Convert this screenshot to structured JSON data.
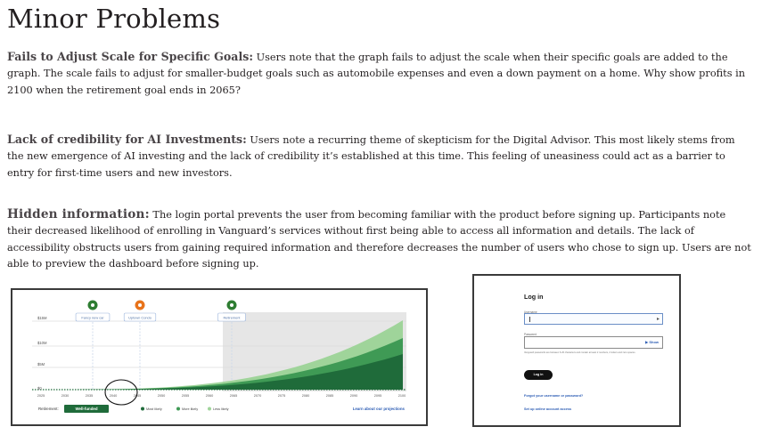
{
  "page": {
    "heading": "Minor Problems",
    "sections": [
      {
        "lead": "Fails to Adjust Scale for Specific Goals:",
        "body": " Users note that the graph fails to adjust the scale when their specific goals are added to the graph. The scale fails to adjust for smaller-budget goals such as automobile expenses and even a down payment on a home. Why show profits in 2100 when the retirement goal ends in 2065?"
      },
      {
        "lead": "Lack of credibility for AI Investments:",
        "body": "  Users note a recurring theme of skepticism for the Digital Advisor. This most likely stems from the new emergence of AI investing and the lack of credibility it’s established at this time. This feeling of uneasiness could act as a barrier to entry for first-time users and new investors."
      },
      {
        "lead": "Hidden information:",
        "body": " The login portal prevents the user from becoming familiar with the product before signing up. Participants note their decreased likelihood of enrolling in Vanguard’s services without first being able to access all information and details. The lack of accessibility obstructs users from gaining required information and therefore decreases the number of users who chose to sign up. Users are not able to preview the dashboard before signing up."
      }
    ]
  },
  "chart_screenshot": {
    "goals": [
      {
        "label": "Fancy new car",
        "icon": "car-icon",
        "color": "#2e7d32"
      },
      {
        "label": "Uptown Condo",
        "icon": "home-icon",
        "color": "#e8731a"
      },
      {
        "label": "Retirement",
        "icon": "retirement-icon",
        "color": "#2e7d32"
      }
    ],
    "y_ticks": [
      "$15M",
      "$10M",
      "$5M",
      "$0"
    ],
    "x_ticks": [
      "2025",
      "2030",
      "2035",
      "2040",
      "2045",
      "2050",
      "2055",
      "2060",
      "2065",
      "2070",
      "2075",
      "2080",
      "2085",
      "2090",
      "2095",
      "2100"
    ],
    "footer": {
      "retirement_label": "Retirement:",
      "status_badge": "Well-funded",
      "legend": [
        "Most likely",
        "More likely",
        "Less likely"
      ],
      "link": "Learn about our projections"
    },
    "colors": {
      "most_likely": "#1f6b3a",
      "more_likely": "#3f9a55",
      "less_likely": "#9fd49a",
      "retirement_shade": "#e6e6e6",
      "highlight_circle": "#111111"
    }
  },
  "login_screenshot": {
    "title": "Log in",
    "username_label": "Username",
    "password_label": "Password",
    "show_label": "Show",
    "password_hint": "Vanguard passwords are between 6-20 characters and contain at least 2 numbers, 2 letters and zero spaces.",
    "login_button": "Log in",
    "forgot_link": "Forgot your username or password?",
    "setup_link": "Set up online account access"
  }
}
